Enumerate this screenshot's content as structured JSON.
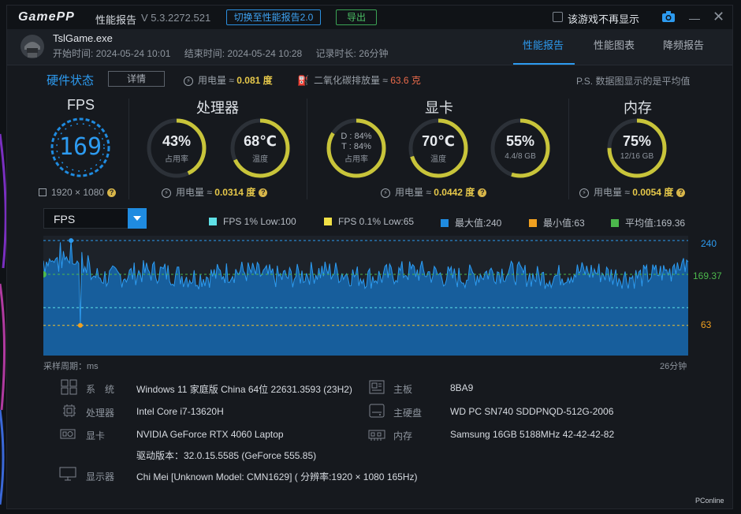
{
  "titlebar": {
    "logo": "GamePP",
    "title": "性能报告",
    "version": "V 5.3.2272.521",
    "switch_label": "切换至性能报告2.0",
    "export_label": "导出",
    "dont_show_label": "该游戏不再显示"
  },
  "header": {
    "exe": "TslGame.exe",
    "start_time": "开始时间: 2024-05-24 10:01",
    "end_time": "结束时间: 2024-05-24 10:28",
    "duration": "记录时长: 26分钟",
    "tabs": [
      {
        "label": "性能报告",
        "active": true
      },
      {
        "label": "性能图表",
        "active": false
      },
      {
        "label": "降频报告",
        "active": false
      }
    ]
  },
  "hardware": {
    "title": "硬件状态",
    "detail_label": "详情",
    "power_prefix": "用电量 ≈ ",
    "power_value": "0.081 度",
    "co2_prefix": "二氧化碳排放量 ≈ ",
    "co2_value": "63.6 克",
    "note": "P.S. 数据图显示的是平均值"
  },
  "sections": {
    "fps": {
      "title": "FPS",
      "value": "169",
      "resolution": "1920 × 1080"
    },
    "cpu": {
      "title": "处理器",
      "usage": "43%",
      "usage_label": "占用率",
      "usage_fraction": 0.43,
      "temp": "68℃",
      "temp_label": "温度",
      "temp_fraction": 0.68,
      "power_prefix": "用电量 ≈ ",
      "power_value": "0.0314 度"
    },
    "gpu": {
      "title": "显卡",
      "d_usage": "D : 84%",
      "t_usage": "T : 84%",
      "usage_label": "占用率",
      "usage_fraction": 0.84,
      "temp": "70℃",
      "temp_label": "温度",
      "temp_fraction": 0.7,
      "vram": "55%",
      "vram_detail": "4.4/8 GB",
      "vram_fraction": 0.55,
      "power_prefix": "用电量 ≈ ",
      "power_value": "0.0442 度"
    },
    "mem": {
      "title": "内存",
      "usage": "75%",
      "usage_detail": "12/16 GB",
      "usage_fraction": 0.75,
      "power_prefix": "用电量 ≈ ",
      "power_value": "0.0054 度"
    }
  },
  "chart_controls": {
    "metric": "FPS",
    "legend": [
      {
        "label": "FPS 1% Low:100",
        "color": "#5fe0e6"
      },
      {
        "label": "FPS 0.1% Low:65",
        "color": "#f0e046"
      },
      {
        "label": "最大值:240",
        "color": "#1f8be0"
      },
      {
        "label": "最小值:63",
        "color": "#f0a020"
      },
      {
        "label": "平均值:169.36",
        "color": "#4cb84c"
      }
    ],
    "x_note_left": "采样周期：ms",
    "x_note_right": "26分钟",
    "label_max": "240",
    "label_avg": "169.37",
    "label_min": "63"
  },
  "chart_data": {
    "type": "area",
    "title": "",
    "xlabel": "采样周期：ms",
    "ylabel": "",
    "max": 240,
    "min": 63,
    "avg": 169.37,
    "low_1pct": 100,
    "low_01pct": 65,
    "ylim": [
      0,
      250
    ],
    "x_range_label": "26分钟"
  },
  "system_info": [
    {
      "label": "系　统",
      "value": "Windows 11 家庭版 China 64位 22631.3593 (23H2)"
    },
    {
      "label": "处理器",
      "value": "Intel Core i7-13620H"
    },
    {
      "label": "显卡",
      "value": "NVIDIA GeForce RTX 4060 Laptop"
    },
    {
      "label": "",
      "value": "驱动版本：32.0.15.5585 (GeForce 555.85)"
    },
    {
      "label": "显示器",
      "value": "Chi Mei [Unknown Model: CMN1629] ( 分辨率:1920 × 1080 165Hz)"
    },
    {
      "label": "主板",
      "value": "8BA9"
    },
    {
      "label": "主硬盘",
      "value": "WD PC SN740 SDDPNQD-512G-2006"
    },
    {
      "label": "内存",
      "value": "Samsung 16GB 5188MHz 42-42-42-82"
    }
  ],
  "watermark": "PConline"
}
